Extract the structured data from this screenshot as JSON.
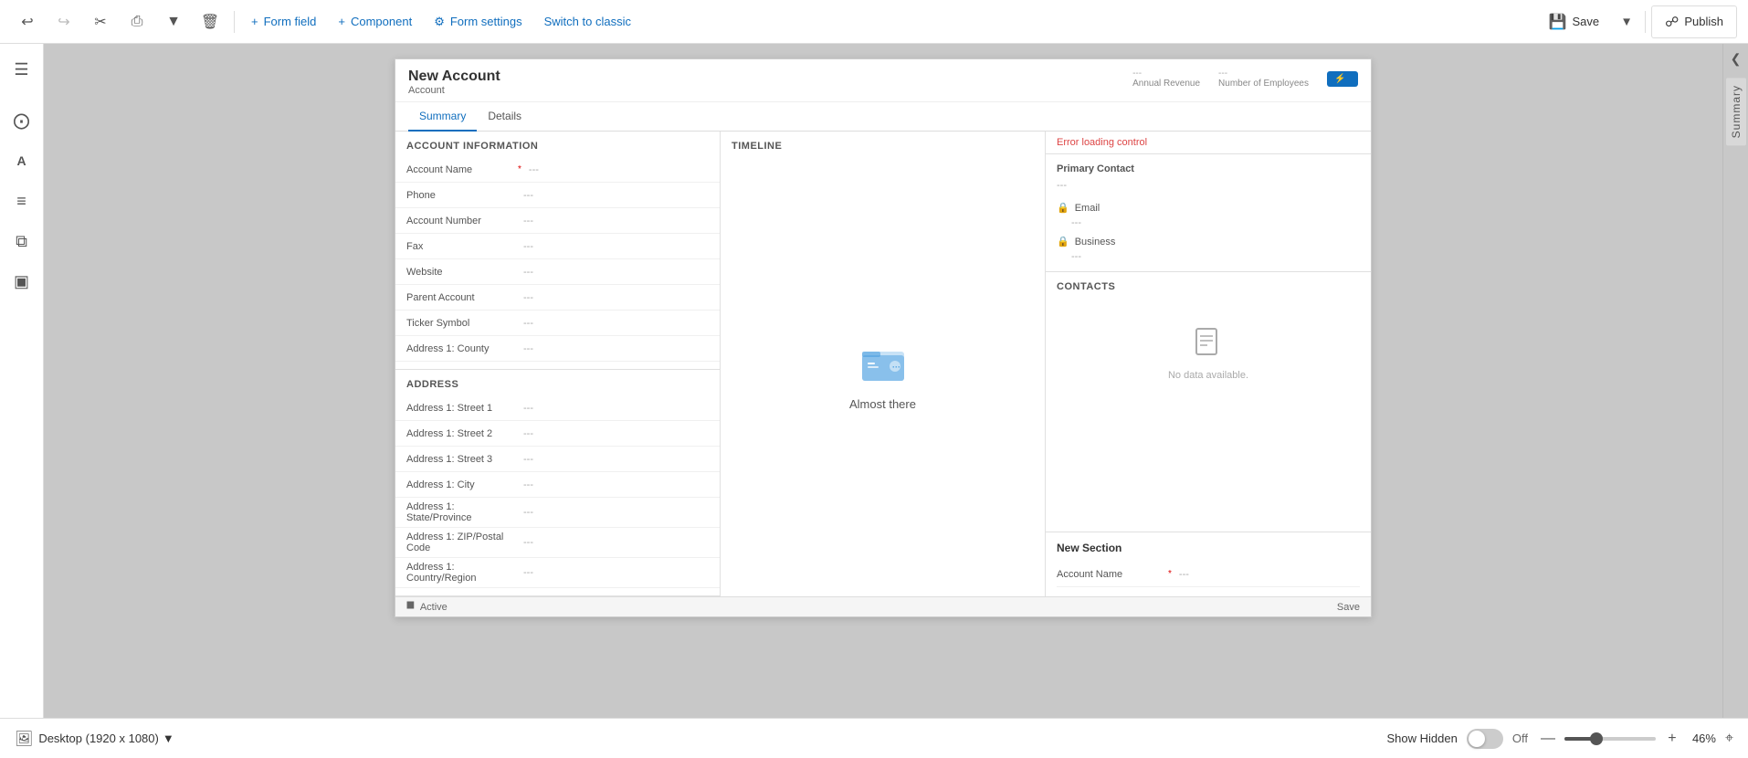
{
  "toolbar": {
    "undo_label": "↩",
    "redo_label": "↪",
    "cut_label": "✂",
    "copy_label": "⎘",
    "dropdown_label": "▾",
    "delete_label": "🗑",
    "form_field_label": "Form field",
    "component_label": "Component",
    "form_settings_label": "Form settings",
    "switch_classic_label": "Switch to classic",
    "save_label": "Save",
    "publish_label": "Publish"
  },
  "sidebar": {
    "menu_icon": "☰",
    "icons": [
      "⊞",
      "A",
      "≡",
      "⧉"
    ]
  },
  "form": {
    "title": "New Account",
    "subtitle": "Account",
    "metrics": [
      {
        "label": "Annual Revenue",
        "value": "---"
      },
      {
        "label": "Number of Employees",
        "value": "---"
      }
    ],
    "tabs": [
      "Summary",
      "Details"
    ],
    "active_tab": "Summary",
    "sections": {
      "account_info": {
        "title": "ACCOUNT INFORMATION",
        "fields": [
          {
            "label": "Account Name",
            "required": true,
            "value": "---"
          },
          {
            "label": "Phone",
            "required": false,
            "value": "---"
          },
          {
            "label": "Account Number",
            "required": false,
            "value": "---"
          },
          {
            "label": "Fax",
            "required": false,
            "value": "---"
          },
          {
            "label": "Website",
            "required": false,
            "value": "---"
          },
          {
            "label": "Parent Account",
            "required": false,
            "value": "---"
          },
          {
            "label": "Ticker Symbol",
            "required": false,
            "value": "---"
          },
          {
            "label": "Address 1: County",
            "required": false,
            "value": "---"
          }
        ]
      },
      "address": {
        "title": "ADDRESS",
        "fields": [
          {
            "label": "Address 1: Street 1",
            "value": "---"
          },
          {
            "label": "Address 1: Street 2",
            "value": "---"
          },
          {
            "label": "Address 1: Street 3",
            "value": "---"
          },
          {
            "label": "Address 1: City",
            "value": "---"
          },
          {
            "label": "Address 1: State/Province",
            "value": "---"
          },
          {
            "label": "Address 1: ZIP/Postal Code",
            "value": "---"
          },
          {
            "label": "Address 1: Country/Region",
            "value": "---"
          }
        ]
      },
      "timeline": {
        "title": "Timeline",
        "icon": "📁",
        "label": "Almost there"
      },
      "right_panel": {
        "error": "Error loading control",
        "primary_contact_label": "Primary Contact",
        "primary_contact_value": "---",
        "email_label": "Email",
        "email_value": "---",
        "business_label": "Business",
        "business_value": "---",
        "contacts_title": "CONTACTS",
        "no_data_text": "No data available.",
        "new_section_title": "New Section",
        "new_section_field_label": "Account Name",
        "new_section_field_required": true,
        "new_section_field_value": "---"
      }
    }
  },
  "canvas_bottom": {
    "status": "Active",
    "save_label": "Save"
  },
  "footer": {
    "desktop_label": "Desktop (1920 x 1080)",
    "show_hidden_label": "Show Hidden",
    "off_label": "Off",
    "zoom_percent": "46%",
    "minus_label": "—",
    "plus_label": "+"
  },
  "right_sidebar_label": "Summary"
}
